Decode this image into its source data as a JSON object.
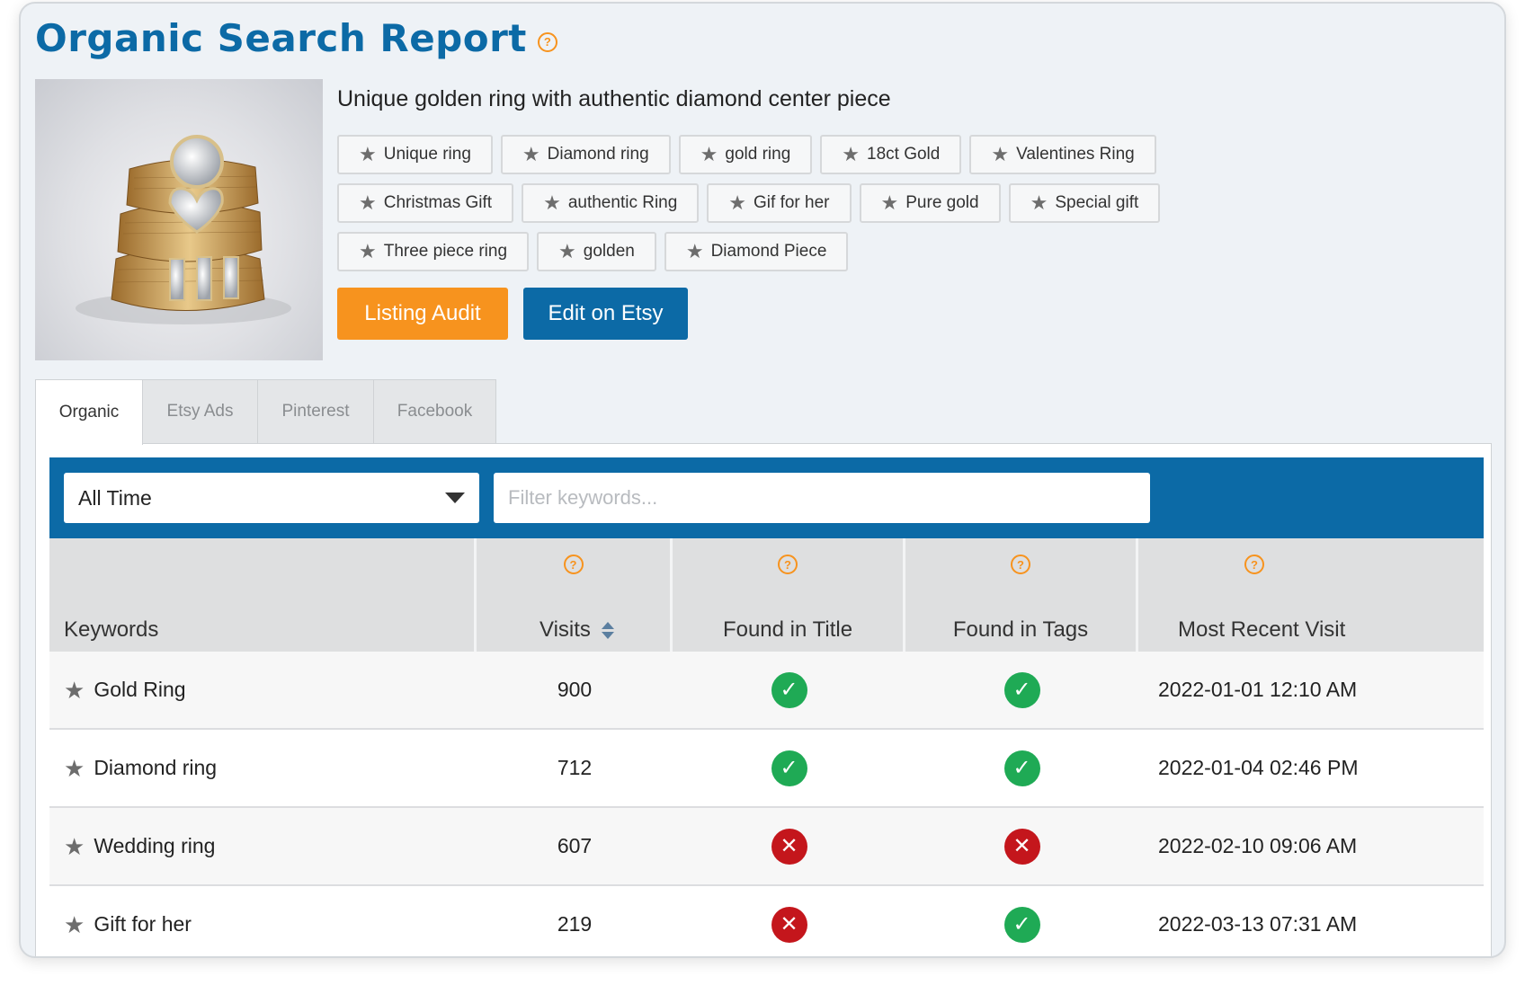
{
  "header": {
    "title": "Organic Search Report",
    "help_icon": "question-circle-icon"
  },
  "product": {
    "description": "Unique golden ring with authentic diamond center piece",
    "image": "ring-photo",
    "tags": [
      [
        "Unique ring",
        "Diamond ring",
        "gold ring",
        "18ct Gold",
        "Valentines Ring"
      ],
      [
        "Christmas Gift",
        "authentic Ring",
        "Gif for her",
        "Pure gold",
        "Special gift"
      ],
      [
        "Three piece ring",
        "golden",
        "Diamond Piece"
      ]
    ]
  },
  "actions": {
    "audit_label": "Listing Audit",
    "edit_label": "Edit on Etsy",
    "audit_color": "#f7931e",
    "edit_color": "#0c6aa6"
  },
  "tabs": [
    {
      "label": "Organic",
      "active": true
    },
    {
      "label": "Etsy Ads",
      "active": false
    },
    {
      "label": "Pinterest",
      "active": false
    },
    {
      "label": "Facebook",
      "active": false
    }
  ],
  "filters": {
    "range_value": "All Time",
    "search_placeholder": "Filter keywords..."
  },
  "table": {
    "columns": [
      "Keywords",
      "Visits",
      "Found in Title",
      "Found in Tags",
      "Most Recent Visit"
    ],
    "rows": [
      {
        "keyword": "Gold Ring",
        "visits": "900",
        "in_title": true,
        "in_tags": true,
        "recent": "2022-01-01 12:10 AM"
      },
      {
        "keyword": "Diamond ring",
        "visits": "712",
        "in_title": true,
        "in_tags": true,
        "recent": "2022-01-04 02:46 PM"
      },
      {
        "keyword": "Wedding ring",
        "visits": "607",
        "in_title": false,
        "in_tags": false,
        "recent": "2022-02-10 09:06 AM"
      },
      {
        "keyword": "Gift for her",
        "visits": "219",
        "in_title": false,
        "in_tags": true,
        "recent": "2022-03-13 07:31 AM"
      }
    ]
  },
  "colors": {
    "brand_blue": "#0c6aa6",
    "accent_orange": "#f7931e",
    "check_green": "#1faa55",
    "cross_red": "#c4161c"
  }
}
